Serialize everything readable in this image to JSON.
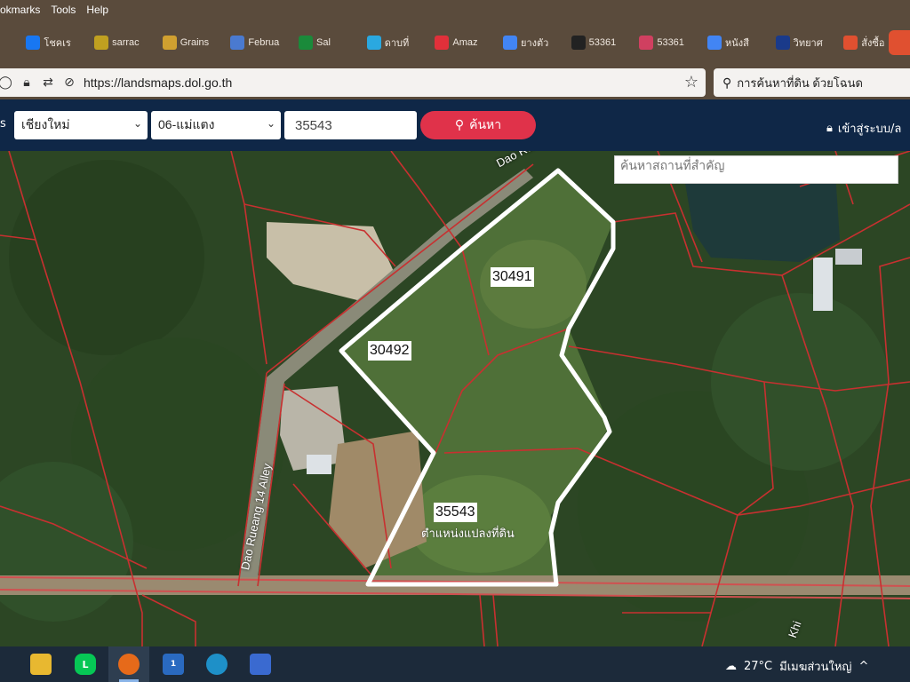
{
  "menu": {
    "bookmarks_label": "okmarks",
    "tools_label": "Tools",
    "help_label": "Help"
  },
  "bookmarks_bar": {
    "items": [
      {
        "label": "",
        "icon": "cut-off-icon"
      },
      {
        "label": "โชคเร",
        "icon": "facebook-icon",
        "color": "#1877f2"
      },
      {
        "label": "sarrac",
        "icon": "bars-icon",
        "color": "#c0a020"
      },
      {
        "label": "Grains",
        "icon": "grains-icon",
        "color": "#d0a030"
      },
      {
        "label": "Februa",
        "icon": "chart-icon",
        "color": "#4a7ad0"
      },
      {
        "label": "Sal",
        "icon": "sheet-icon",
        "color": "#1a8a3a"
      },
      {
        "label": "ดาบที่",
        "icon": "play-icon",
        "color": "#2aa8e0"
      },
      {
        "label": "Amaz",
        "icon": "heart-icon",
        "color": "#e0303a"
      },
      {
        "label": "ยางตัว",
        "icon": "google-icon",
        "color": "#4285f4"
      },
      {
        "label": "53361",
        "icon": "n-icon",
        "color": "#222222"
      },
      {
        "label": "53361",
        "icon": "b-icon",
        "color": "#d04060"
      },
      {
        "label": "หนังสื",
        "icon": "google-icon",
        "color": "#4285f4"
      },
      {
        "label": "วิทยาศ",
        "icon": "news-icon",
        "color": "#1a3a8a"
      },
      {
        "label": "สั่งซื้อ",
        "icon": "shop-icon",
        "color": "#e05030"
      }
    ]
  },
  "address_bar": {
    "url": "https://landsmaps.dol.go.th"
  },
  "browser_search": {
    "text": "การค้นหาที่ดิน ด้วยโฉนด"
  },
  "site_header": {
    "partial_label": "s",
    "province": "เชียงใหม่",
    "district": "06-แม่แตง",
    "parcel_number": "35543",
    "search_button": "ค้นหา",
    "login": "เข้าสู่ระบบ/ล"
  },
  "map": {
    "place_search_placeholder": "ค้นหาสถานที่สำคัญ",
    "parcels": [
      {
        "number": "30491"
      },
      {
        "number": "30492"
      },
      {
        "number": "35543",
        "subtitle": "ตำแหน่งแปลงที่ดิน"
      }
    ],
    "roads": [
      "Dao Rueang",
      "Dao Rueang 14 Alley",
      "Khi"
    ]
  },
  "taskbar": {
    "weather": "27°C",
    "weather_text": "มีเมฆส่วนใหญ่",
    "mail_badge": "1",
    "tray_chevron": "^"
  },
  "colors": {
    "header_bg": "#0f2747",
    "search_btn": "#e0324a",
    "parcel_line": "#c83030",
    "selected_outline": "#ffffff"
  }
}
